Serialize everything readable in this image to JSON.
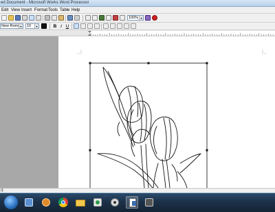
{
  "window": {
    "title": "ed Document - Microsoft Works Word Processor"
  },
  "menu": [
    {
      "label": "Edit"
    },
    {
      "label": "View"
    },
    {
      "label": "Insert"
    },
    {
      "label": "Format"
    },
    {
      "label": "Tools"
    },
    {
      "label": "Table"
    },
    {
      "label": "Help"
    }
  ],
  "toolbar": {
    "zoom_value": "100%",
    "zoom_arrow": "▾"
  },
  "format_bar": {
    "font_name": "New Roman",
    "font_size": "10",
    "bold_label": "B",
    "italic_label": "I",
    "underline_label": "U"
  },
  "status": {
    "page_indicator": "/1"
  },
  "taskbar": {
    "items": [
      {
        "icon": "windows-start-icon"
      },
      {
        "icon": "task-manager-icon"
      },
      {
        "icon": "media-player-icon"
      },
      {
        "icon": "chrome-icon"
      },
      {
        "icon": "folder-icon"
      },
      {
        "icon": "paint-icon"
      },
      {
        "icon": "camera-icon"
      },
      {
        "icon": "works-word-processor-icon"
      },
      {
        "icon": "app-window-icon"
      }
    ]
  },
  "colors": {
    "titlebar": "#c8dcf0",
    "taskbar": "#1c3148",
    "help_button": "#d02020"
  }
}
